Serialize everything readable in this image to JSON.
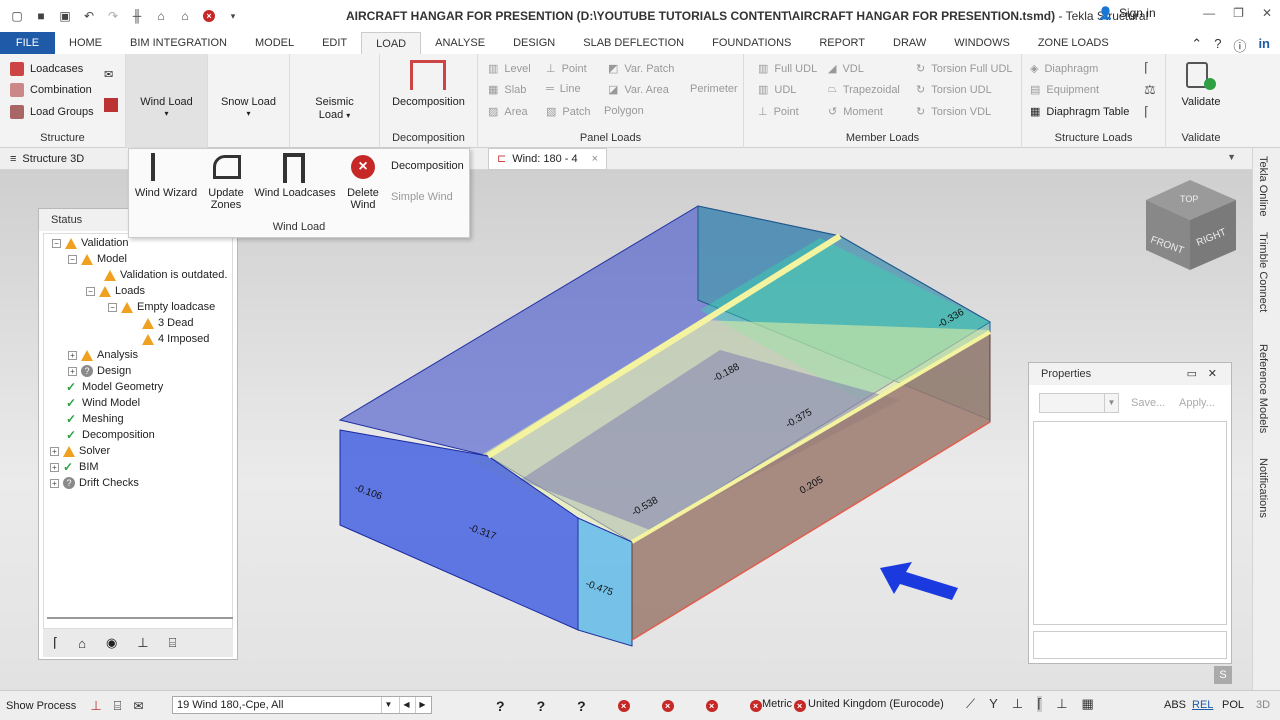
{
  "window": {
    "title": "AIRCRAFT HANGAR FOR PRESENTION (D:\\YOUTUBE TUTORIALS CONTENT\\AIRCRAFT HANGAR FOR PRESENTION.tsmd)",
    "app_name": "- Tekla Structural",
    "signin": "Sign in"
  },
  "tabs": [
    "FILE",
    "HOME",
    "BIM INTEGRATION",
    "MODEL",
    "EDIT",
    "LOAD",
    "ANALYSE",
    "DESIGN",
    "SLAB DEFLECTION",
    "FOUNDATIONS",
    "REPORT",
    "DRAW",
    "WINDOWS",
    "ZONE LOADS"
  ],
  "ribbon": {
    "structure": {
      "items": [
        "Loadcases",
        "Combination",
        "Load Groups"
      ],
      "label": "Structure"
    },
    "wind_load": "Wind Load",
    "snow_load": "Snow Load",
    "seismic_load_1": "Seismic",
    "seismic_load_2": "Load",
    "decomposition": {
      "button": "Decomposition",
      "label": "Decomposition"
    },
    "panel_loads": {
      "items": [
        "Level",
        "Point",
        "Var. Patch",
        "Slab",
        "Line",
        "Var. Area",
        "Perimeter",
        "Area",
        "Patch",
        "Polygon"
      ],
      "label": "Panel Loads"
    },
    "member_loads": {
      "items": [
        "Full UDL",
        "VDL",
        "Torsion Full UDL",
        "UDL",
        "Trapezoidal",
        "Torsion UDL",
        "Point",
        "Moment",
        "Torsion VDL"
      ],
      "label": "Member Loads"
    },
    "structure_loads": {
      "items": [
        "Diaphragm",
        "Equipment",
        "Diaphragm Table"
      ],
      "label": "Structure Loads"
    },
    "validate": {
      "button": "Validate",
      "label": "Validate"
    }
  },
  "dropdown": {
    "wind_wizard": "Wind Wizard",
    "update_1": "Update",
    "update_2": "Zones",
    "wind_loadcases": "Wind Loadcases",
    "delete_1": "Delete",
    "delete_2": "Wind",
    "decomposition": "Decomposition",
    "simple_wind": "Simple Wind",
    "label": "Wind Load"
  },
  "doc_tabs": {
    "structure3d": "Structure 3D",
    "wind": "Wind: 180 - 4"
  },
  "status_panel": {
    "title": "Status",
    "tree": [
      {
        "text": "Validation",
        "icon": "warn"
      },
      {
        "text": "Model",
        "icon": "warn"
      },
      {
        "text": "Validation is outdated.",
        "icon": "warn"
      },
      {
        "text": "Loads",
        "icon": "warn"
      },
      {
        "text": "Empty loadcase",
        "icon": "warn"
      },
      {
        "text": "3 Dead",
        "icon": "warn"
      },
      {
        "text": "4 Imposed",
        "icon": "warn"
      },
      {
        "text": "Analysis",
        "icon": "warn"
      },
      {
        "text": "Design",
        "icon": "question"
      },
      {
        "text": "Model Geometry",
        "icon": "check"
      },
      {
        "text": "Wind Model",
        "icon": "check"
      },
      {
        "text": "Meshing",
        "icon": "check"
      },
      {
        "text": "Decomposition",
        "icon": "check"
      },
      {
        "text": "Solver",
        "icon": "warn"
      },
      {
        "text": "BIM",
        "icon": "check"
      },
      {
        "text": "Drift Checks",
        "icon": "question"
      }
    ]
  },
  "properties": {
    "title": "Properties",
    "save": "Save...",
    "apply": "Apply..."
  },
  "view_cube": {
    "top": "TOP",
    "front": "FRONT",
    "right": "RIGHT"
  },
  "model_labels": [
    "-0.188",
    "-0.317",
    "-0.475",
    "-0.375",
    "0.205",
    "-0.538",
    "-0.336",
    "-0.106"
  ],
  "right_panels": [
    "Tekla Online",
    "Trimble Connect",
    "Reference Models",
    "Notifications"
  ],
  "statusbar": {
    "show_process": "Show Process",
    "loadcase": "19 Wind 180,-Cpe, All",
    "metric": "Metric",
    "code": "United Kingdom (Eurocode)",
    "abs": "ABS",
    "rel": "REL",
    "pol": "POL",
    "threed": "3D"
  }
}
